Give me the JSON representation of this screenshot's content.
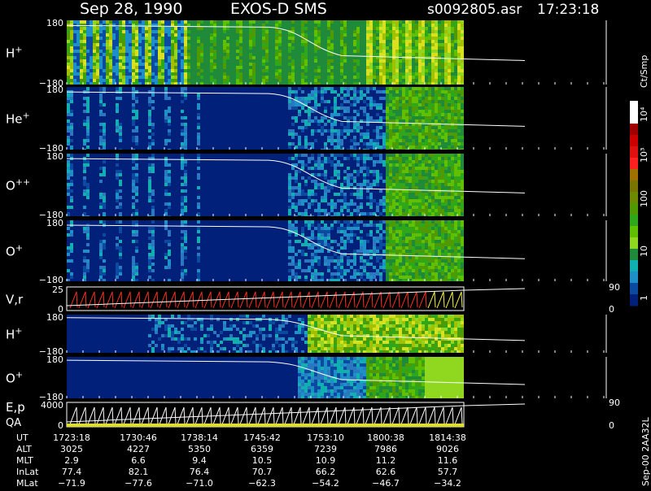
{
  "header": {
    "date": "Sep 28, 1990",
    "instrument": "EXOS-D SMS",
    "file": "s0092805.asr",
    "time": "17:23:18"
  },
  "colorbar": {
    "unit": "Ct/Smp",
    "tick_labels": [
      "10⁴",
      "10³",
      "100",
      "10",
      "1"
    ],
    "colors": [
      "#ffffff",
      "#ffffff",
      "#a00000",
      "#cc0000",
      "#e01010",
      "#ff2020",
      "#a07000",
      "#7a7400",
      "#6e8a00",
      "#4f9a00",
      "#2ea81a",
      "#60c000",
      "#90d820",
      "#1f8a3a",
      "#10b0b0",
      "#1e90c8",
      "#0a4aa0",
      "#00207a"
    ]
  },
  "panels": [
    {
      "id": "h-plus-top",
      "label": "H",
      "sup": "+",
      "ymax": "180",
      "ymin": "−180",
      "style": "hot"
    },
    {
      "id": "he-plus",
      "label": "He",
      "sup": "+",
      "ymax": "180",
      "ymin": "−180",
      "style": "mid"
    },
    {
      "id": "o-plus-plus",
      "label": "O",
      "sup": "++",
      "ymax": "180",
      "ymin": "−180",
      "style": "mid"
    },
    {
      "id": "o-plus-top",
      "label": "O",
      "sup": "+",
      "ymax": "180",
      "ymin": "−180",
      "style": "mid"
    },
    {
      "id": "vr",
      "label": "V,r",
      "ymax": "25",
      "ymin": "0",
      "right_top": "90",
      "right_bottom": "0",
      "style": "line"
    },
    {
      "id": "h-plus-bottom",
      "label": "H",
      "sup": "+",
      "ymax": "180",
      "ymin": "−180",
      "style": "late"
    },
    {
      "id": "o-plus-bottom",
      "label": "O",
      "sup": "+",
      "ymax": "180",
      "ymin": "−180",
      "style": "late2"
    },
    {
      "id": "ep",
      "label": "E,p",
      "label2": "QA",
      "ymax": "4000",
      "ymin": "0",
      "right_top": "90",
      "right_bottom": "0",
      "style": "line2"
    }
  ],
  "orbit_table": {
    "rows": [
      {
        "name": "UT",
        "values": [
          "1723:18",
          "1730:46",
          "1738:14",
          "1745:42",
          "1753:10",
          "1800:38",
          "1814:38"
        ]
      },
      {
        "name": "ALT",
        "values": [
          "3025",
          "4227",
          "5350",
          "6359",
          "7239",
          "7986",
          "9026"
        ]
      },
      {
        "name": "MLT",
        "values": [
          "2.9",
          "6.6",
          "9.4",
          "10.5",
          "10.9",
          "11.2",
          "11.6"
        ]
      },
      {
        "name": "InLat",
        "values": [
          "77.4",
          "82.1",
          "76.4",
          "70.7",
          "66.2",
          "62.6",
          "57.7"
        ]
      },
      {
        "name": "MLat",
        "values": [
          "−71.9",
          "−77.6",
          "−71.0",
          "−62.3",
          "−54.2",
          "−46.7",
          "−34.2"
        ]
      }
    ]
  },
  "side_note": "Sep-00 2AA32L"
}
